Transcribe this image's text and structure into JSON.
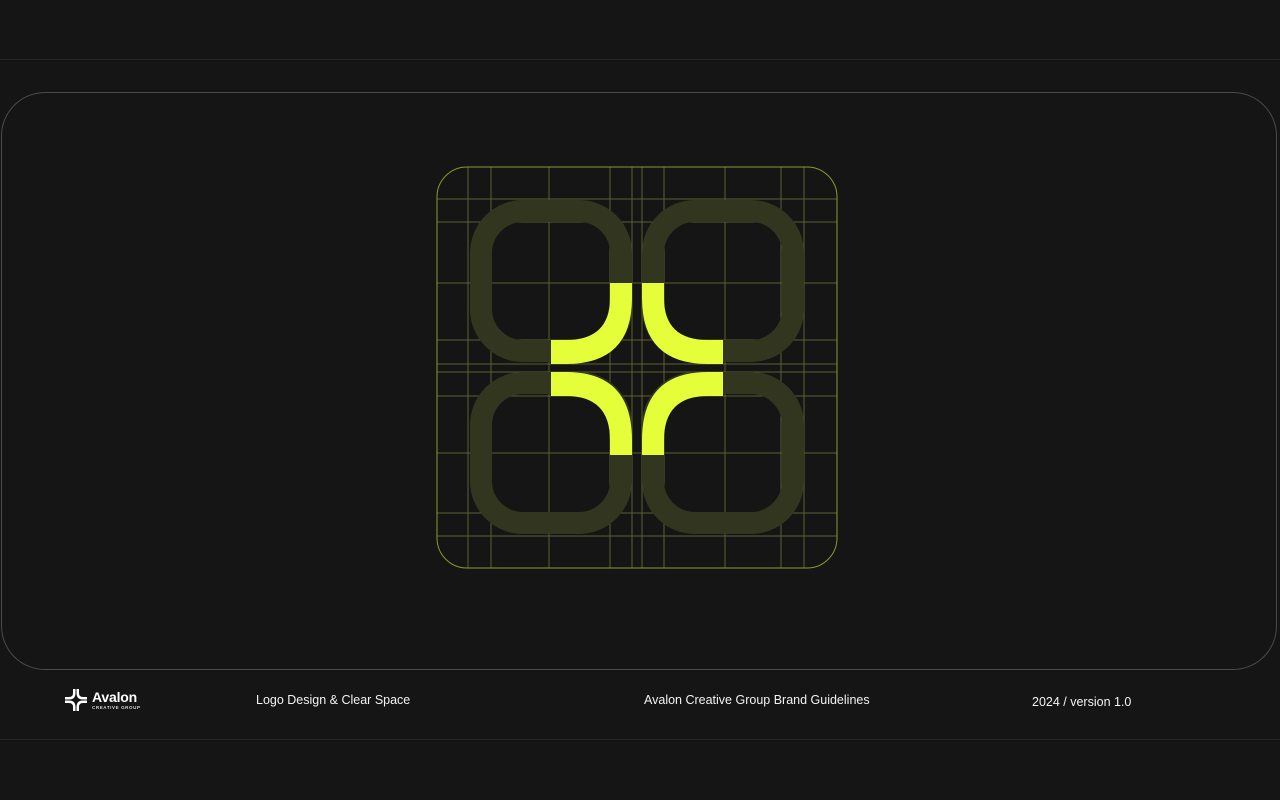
{
  "colors": {
    "background": "#151515",
    "accent": "#e4ff3a",
    "accent_dim": "#33361f",
    "grid_line": "#5b6032",
    "frame_line": "#4a4a47",
    "text": "#f2f2f2"
  },
  "brand": {
    "name": "Avalon",
    "sub": "CREATIVE GROUP",
    "icon": "avalon-star-logo-icon"
  },
  "footer": {
    "section": "Logo Design & Clear Space",
    "document": "Avalon Creative Group Brand Guidelines",
    "version": "2024 / version 1.0"
  },
  "logo_construction": {
    "mark": "four-arc-star",
    "grid_columns": 14,
    "grid_rows": 14,
    "guides": [
      "grid",
      "construction-circles",
      "clear-space-frame"
    ]
  }
}
